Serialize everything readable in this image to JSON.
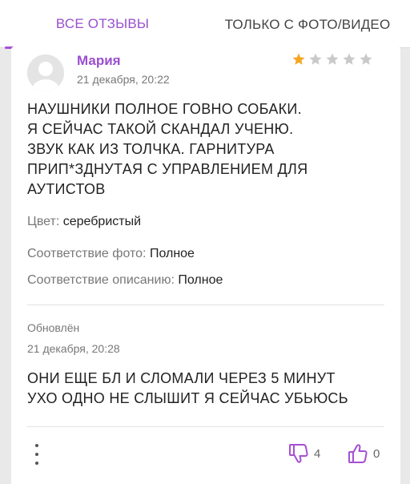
{
  "tabs": {
    "all": "ВСЕ ОТЗЫВЫ",
    "photo_line1": "ТОЛЬКО С ФОТО/",
    "photo_line2": "ВИДЕО"
  },
  "review": {
    "author": "Мария",
    "date": "21 декабря, 20:22",
    "rating": 1,
    "rating_max": 5,
    "text_lines": [
      "НАУШНИКИ ПОЛНОЕ ГОВНО СОБАКИ.",
      "Я СЕЙЧАС ТАКОЙ СКАНДАЛ УЧЕНЮ.",
      "ЗВУК КАК ИЗ ТОЛЧКА. ГАРНИТУРА",
      "ПРИП*ЗДНУТАЯ С УПРАВЛЕНИЕМ ДЛЯ",
      "АУТИСТОВ"
    ],
    "attributes": [
      {
        "label": "Цвет:",
        "value": "серебристый"
      },
      {
        "label": "Соответствие фото:",
        "value": "Полное"
      },
      {
        "label": "Соответствие описанию:",
        "value": "Полное"
      }
    ],
    "updated_label": "Обновлён",
    "updated_date": "21 декабря, 20:28",
    "update_lines": [
      "ОНИ ЕЩЕ БЛ И СЛОМАЛИ ЧЕРЕЗ 5 МИНУТ",
      "УХО ОДНО НЕ СЛЫШИТ Я СЕЙЧАС УБЬЮСЬ"
    ],
    "dislikes": "4",
    "likes": "0"
  },
  "colors": {
    "accent": "#9a4fd0",
    "star_filled": "#f5a623",
    "star_empty": "#c9c9c9",
    "background": "#e9e9e9"
  }
}
